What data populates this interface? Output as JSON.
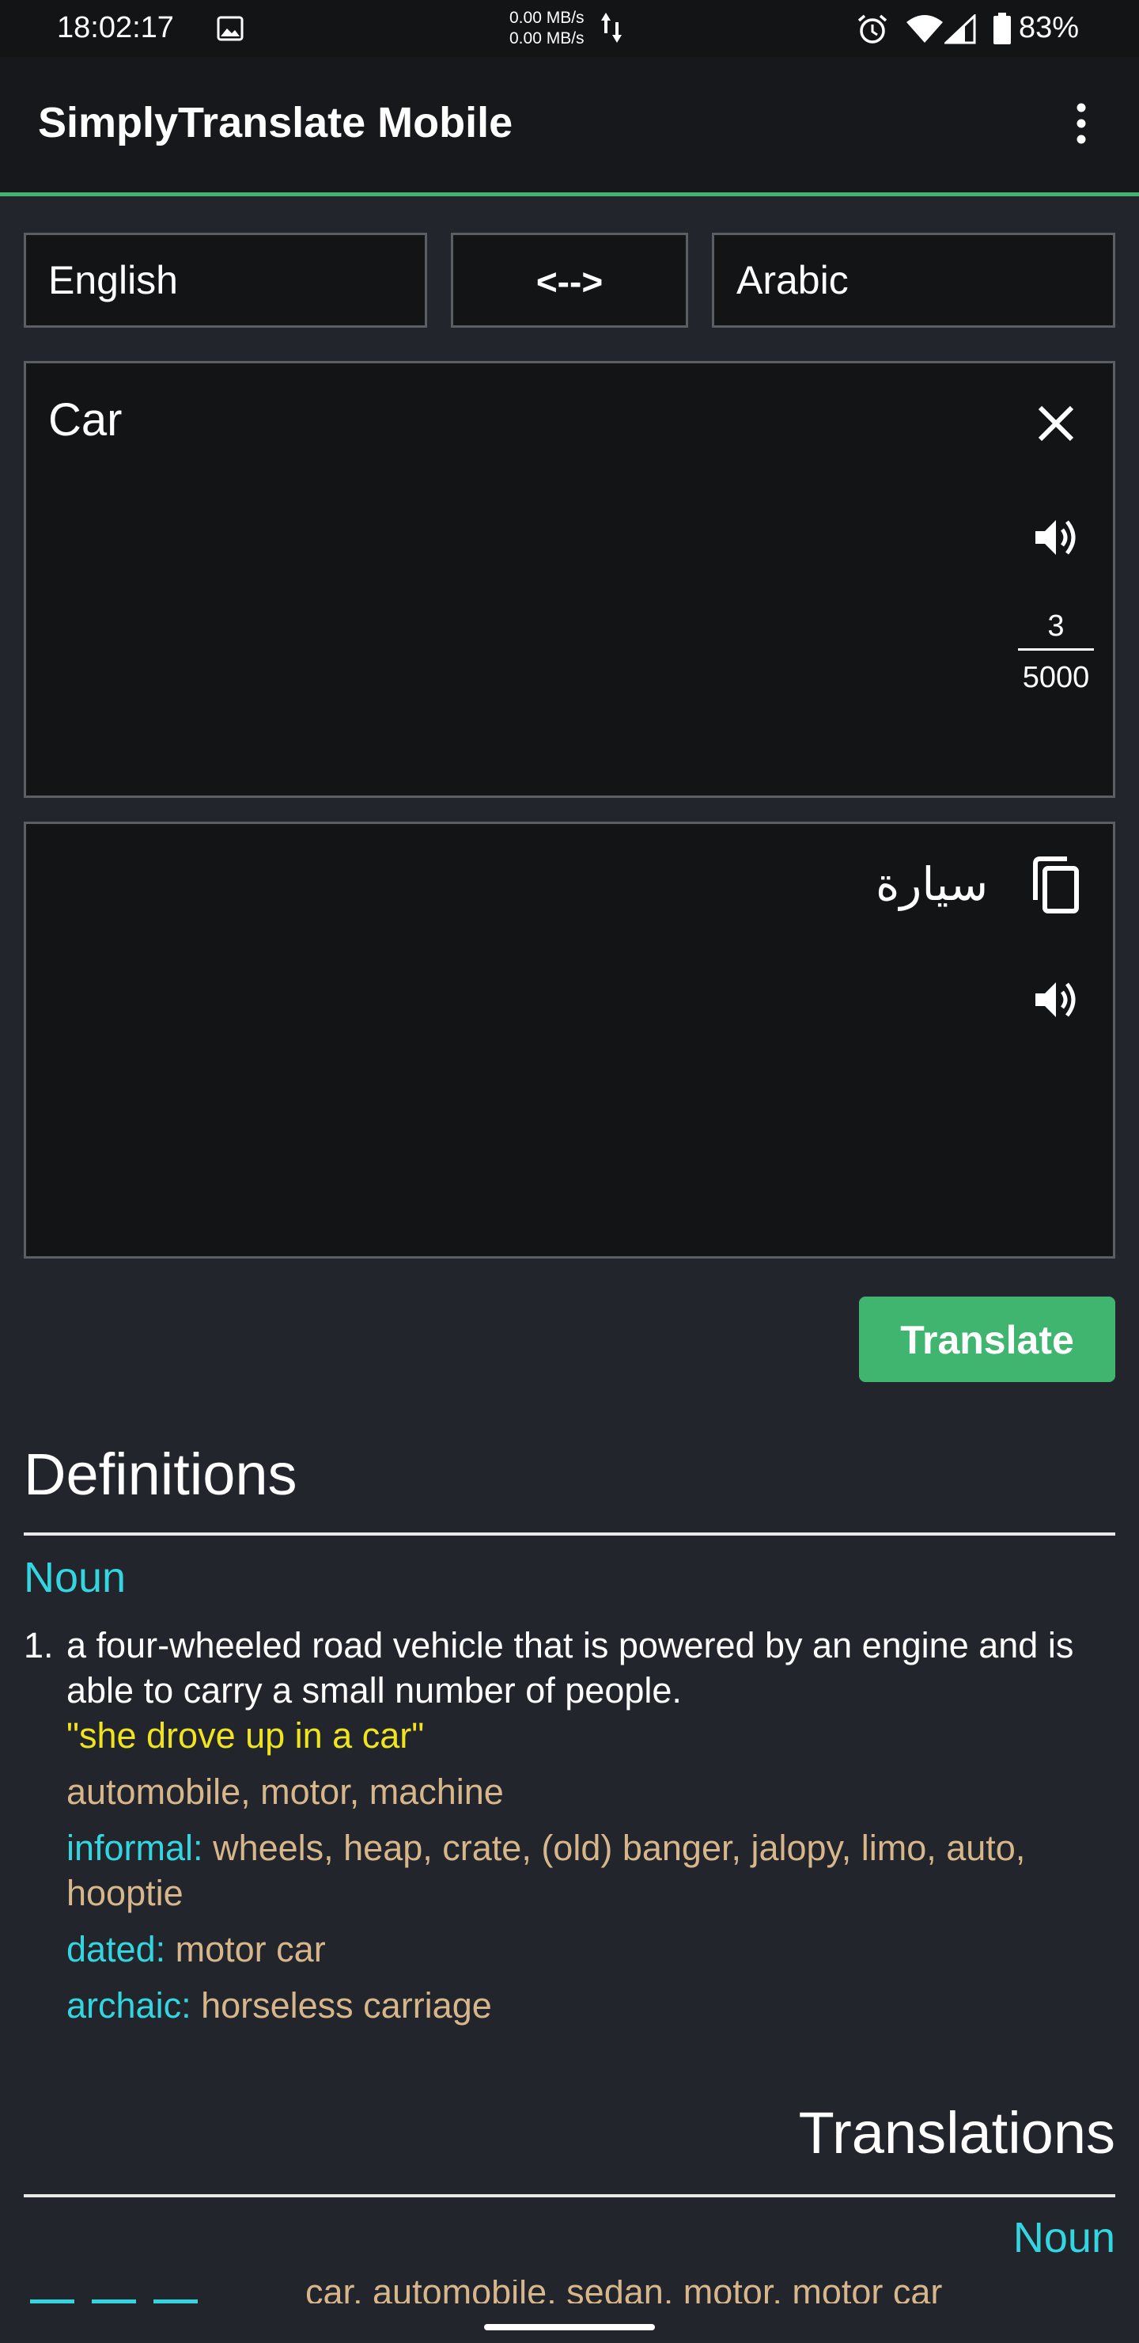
{
  "status_bar": {
    "time": "18:02:17",
    "net_up": "0.00 MB/s",
    "net_down": "0.00 MB/s",
    "battery": "83%"
  },
  "app_bar": {
    "title": "SimplyTranslate Mobile",
    "accent_color": "#3fb56f"
  },
  "languages": {
    "source": "English",
    "swap_label": "<-->",
    "target": "Arabic"
  },
  "input": {
    "text": "Car",
    "char_count": "3",
    "char_max": "5000"
  },
  "output": {
    "text": "سيارة"
  },
  "translate_button": "Translate",
  "definitions": {
    "heading": "Definitions",
    "part_of_speech": "Noun",
    "items": [
      {
        "number": "1.",
        "definition": "a four-wheeled road vehicle that is powered by an engine and is able to carry a small number of people.",
        "example": "\"she drove up in a car\"",
        "synonyms": "automobile, motor, machine",
        "informal_label": "informal:",
        "informal": "wheels, heap, crate, (old) banger, jalopy, limo, auto, hooptie",
        "dated_label": "dated:",
        "dated": "motor car",
        "archaic_label": "archaic:",
        "archaic": "horseless carriage"
      }
    ]
  },
  "translations": {
    "heading": "Translations",
    "part_of_speech": "Noun",
    "first_row_words": "car, automobile, sedan, motor, motor car"
  }
}
